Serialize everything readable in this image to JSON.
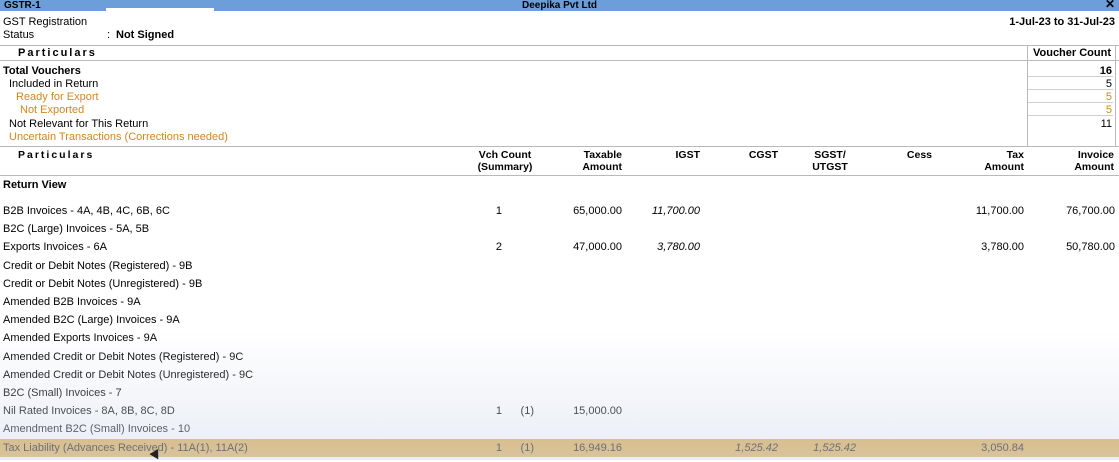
{
  "window": {
    "left_title": "GSTR-1",
    "company": "Deepika Pvt Ltd",
    "close_icon": "close-icon"
  },
  "info": {
    "gst_label": "GST Registration",
    "status_label": "Status",
    "status_sep": ":",
    "status_value": "Not Signed",
    "period": "1-Jul-23 to 31-Jul-23"
  },
  "summary": {
    "particulars_header": "Particulars",
    "count_header": "Voucher Count",
    "rows": [
      {
        "label": "Total Vouchers",
        "value": "16"
      },
      {
        "label": "Included in Return",
        "value": "5"
      },
      {
        "label": "Ready for Export",
        "value": "5"
      },
      {
        "label": "Not Exported",
        "value": "5"
      },
      {
        "label": "Not Relevant for This Return",
        "value": "11"
      },
      {
        "label": "Uncertain Transactions (Corrections needed)",
        "value": ""
      }
    ]
  },
  "table": {
    "headers": {
      "particulars": "Particulars",
      "vch_count_1": "Vch Count",
      "vch_count_2": "(Summary)",
      "taxable_1": "Taxable",
      "taxable_2": "Amount",
      "igst": "IGST",
      "cgst": "CGST",
      "sgst_1": "SGST/",
      "sgst_2": "UTGST",
      "cess": "Cess",
      "tax_1": "Tax",
      "tax_2": "Amount",
      "invoice_1": "Invoice",
      "invoice_2": "Amount"
    },
    "section_title": "Return View",
    "rows": [
      {
        "label": "B2B Invoices - 4A, 4B, 4C, 6B, 6C",
        "vch": "1",
        "sum": "",
        "taxable": "65,000.00",
        "igst": "11,700.00",
        "cgst": "",
        "sgst": "",
        "tax": "11,700.00",
        "invoice": "76,700.00"
      },
      {
        "label": "B2C (Large) Invoices - 5A, 5B",
        "vch": "",
        "sum": "",
        "taxable": "",
        "igst": "",
        "cgst": "",
        "sgst": "",
        "tax": "",
        "invoice": ""
      },
      {
        "label": "Exports Invoices - 6A",
        "vch": "2",
        "sum": "",
        "taxable": "47,000.00",
        "igst": "3,780.00",
        "cgst": "",
        "sgst": "",
        "tax": "3,780.00",
        "invoice": "50,780.00"
      },
      {
        "label": "Credit or Debit Notes (Registered) - 9B",
        "vch": "",
        "sum": "",
        "taxable": "",
        "igst": "",
        "cgst": "",
        "sgst": "",
        "tax": "",
        "invoice": ""
      },
      {
        "label": "Credit or Debit Notes (Unregistered) - 9B",
        "vch": "",
        "sum": "",
        "taxable": "",
        "igst": "",
        "cgst": "",
        "sgst": "",
        "tax": "",
        "invoice": ""
      },
      {
        "label": "Amended B2B Invoices - 9A",
        "vch": "",
        "sum": "",
        "taxable": "",
        "igst": "",
        "cgst": "",
        "sgst": "",
        "tax": "",
        "invoice": ""
      },
      {
        "label": "Amended B2C (Large) Invoices - 9A",
        "vch": "",
        "sum": "",
        "taxable": "",
        "igst": "",
        "cgst": "",
        "sgst": "",
        "tax": "",
        "invoice": ""
      },
      {
        "label": "Amended Exports Invoices - 9A",
        "vch": "",
        "sum": "",
        "taxable": "",
        "igst": "",
        "cgst": "",
        "sgst": "",
        "tax": "",
        "invoice": ""
      },
      {
        "label": "Amended Credit or Debit Notes (Registered) - 9C",
        "vch": "",
        "sum": "",
        "taxable": "",
        "igst": "",
        "cgst": "",
        "sgst": "",
        "tax": "",
        "invoice": ""
      },
      {
        "label": "Amended Credit or Debit Notes (Unregistered) - 9C",
        "vch": "",
        "sum": "",
        "taxable": "",
        "igst": "",
        "cgst": "",
        "sgst": "",
        "tax": "",
        "invoice": ""
      },
      {
        "label": "B2C (Small) Invoices - 7",
        "vch": "",
        "sum": "",
        "taxable": "",
        "igst": "",
        "cgst": "",
        "sgst": "",
        "tax": "",
        "invoice": ""
      },
      {
        "label": "Nil Rated Invoices - 8A, 8B, 8C, 8D",
        "vch": "1",
        "sum": "(1)",
        "taxable": "15,000.00",
        "igst": "",
        "cgst": "",
        "sgst": "",
        "tax": "",
        "invoice": ""
      },
      {
        "label": "Amendment B2C (Small) Invoices - 10",
        "vch": "",
        "sum": "",
        "taxable": "",
        "igst": "",
        "cgst": "",
        "sgst": "",
        "tax": "",
        "invoice": ""
      },
      {
        "label": "Tax Liability (Advances Received) - 11A(1), 11A(2)",
        "vch": "1",
        "sum": "(1)",
        "taxable": "16,949.16",
        "igst": "",
        "cgst": "1,525.42",
        "sgst": "1,525.42",
        "tax": "3,050.84",
        "invoice": ""
      }
    ]
  }
}
